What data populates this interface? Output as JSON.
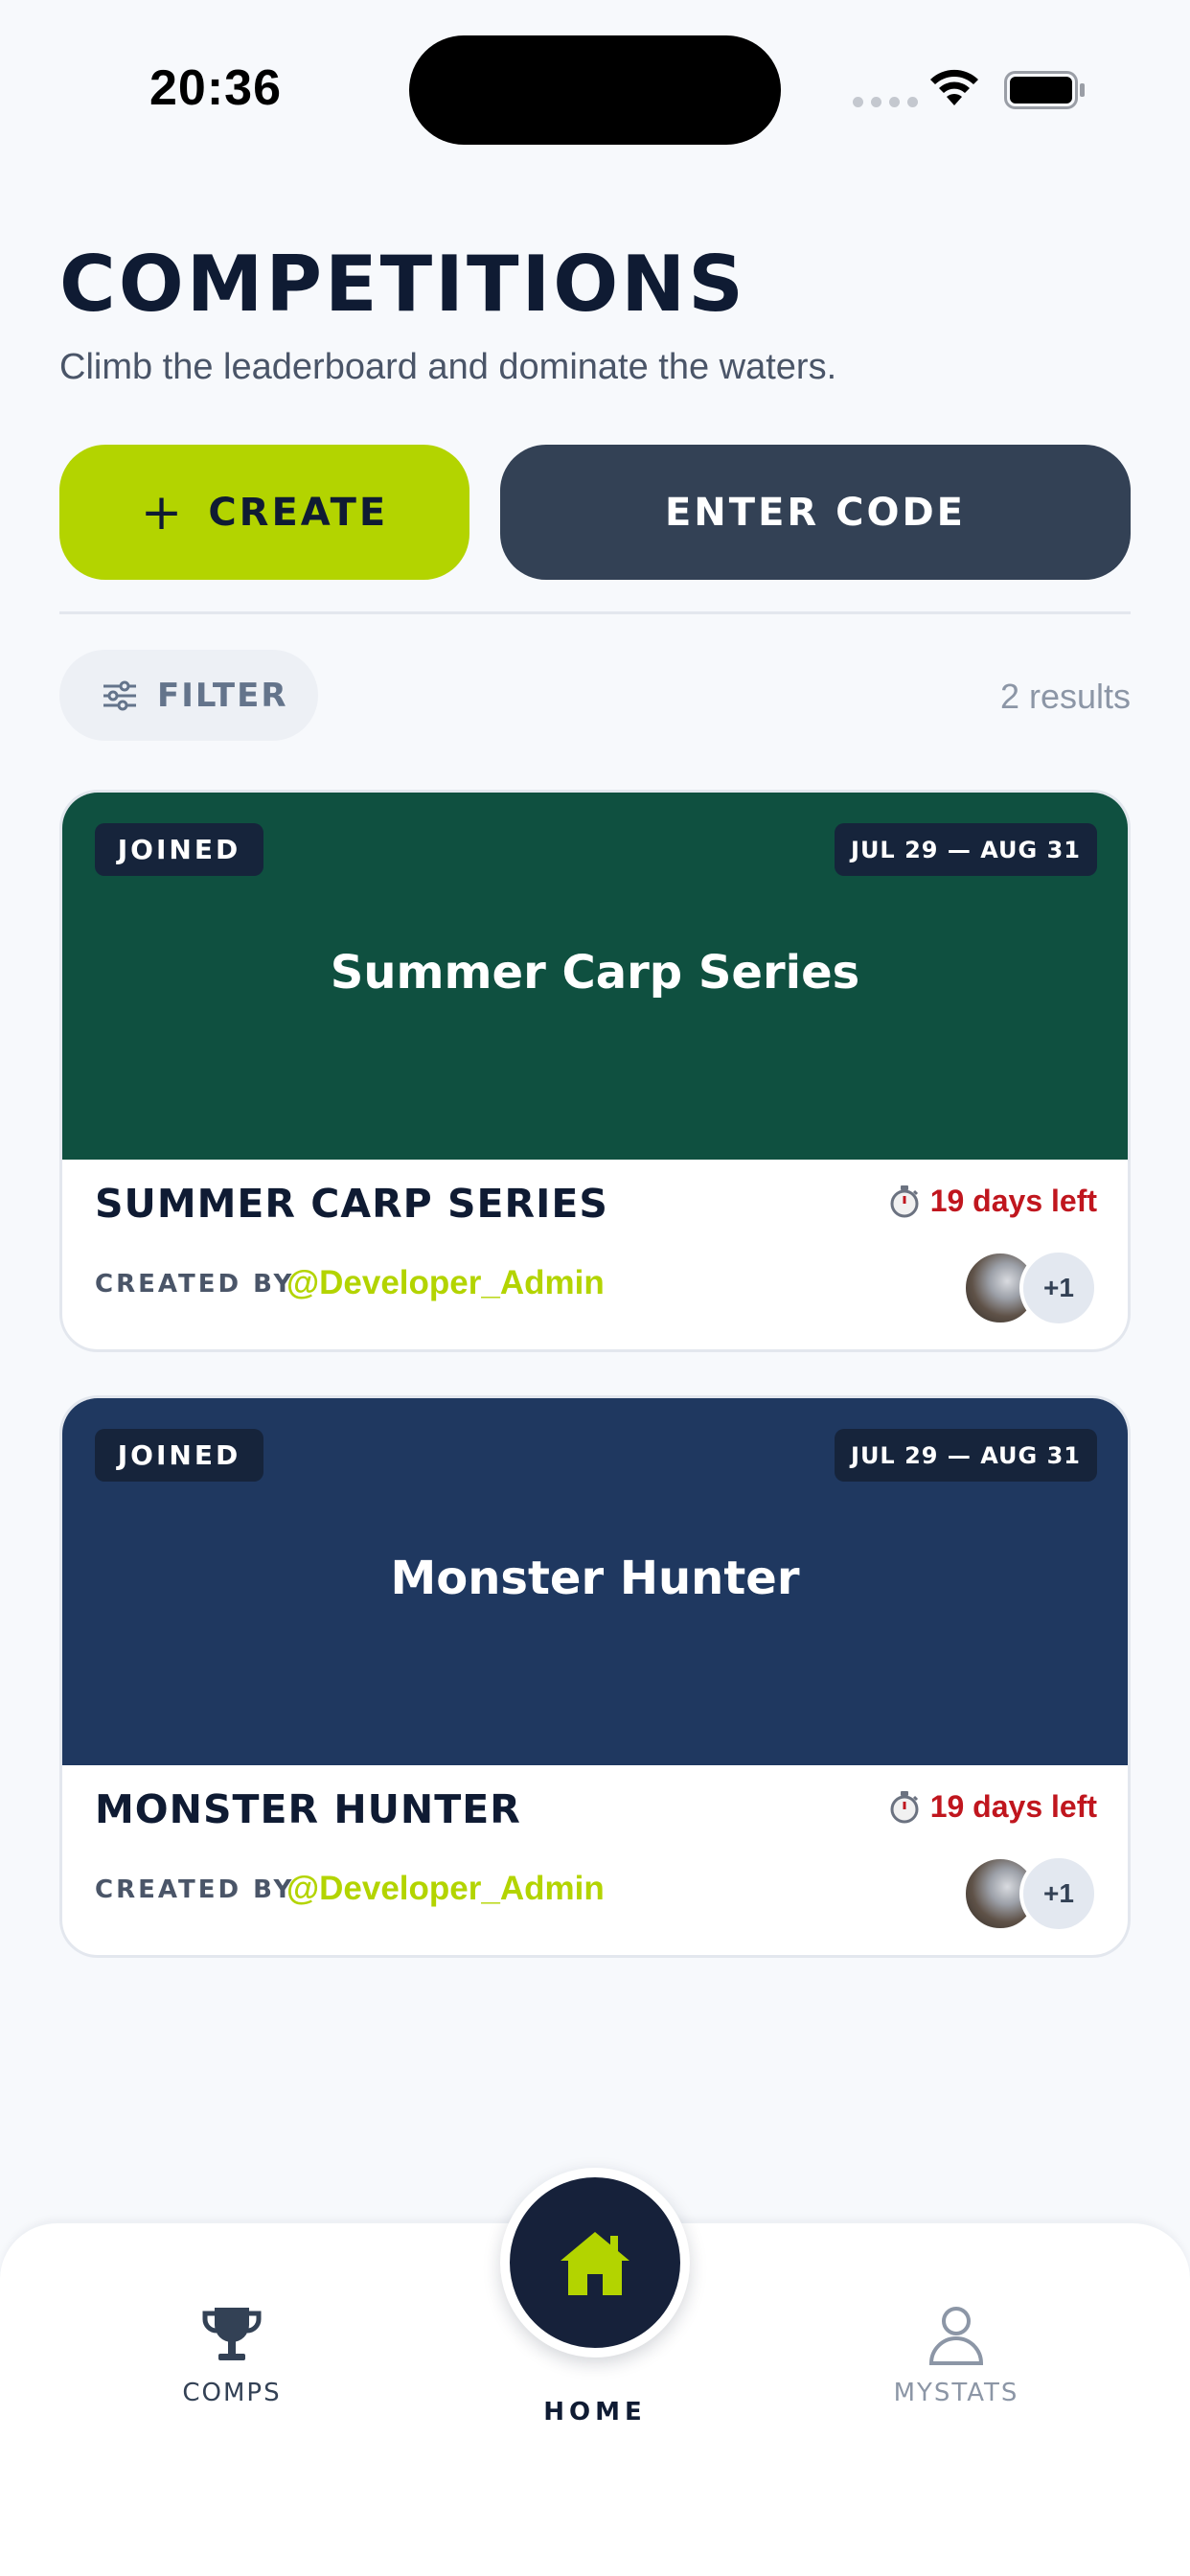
{
  "status_bar": {
    "time": "20:36"
  },
  "header": {
    "title": "COMPETITIONS",
    "subtitle": "Climb the leaderboard and dominate the waters."
  },
  "actions": {
    "create_label": "CREATE",
    "create_symbol": "+",
    "enter_code_label": "ENTER CODE"
  },
  "filter": {
    "label": "FILTER",
    "results": "2 results"
  },
  "competitions": [
    {
      "badge": "JOINED",
      "dates": "JUL 29 — AUG 31",
      "banner_title": "Summer Carp Series",
      "banner_color": "#0f5040",
      "name": "SUMMER CARP SERIES",
      "time_left": "19 days left",
      "created_by_label": "CREATED BY",
      "creator": "@Developer_Admin",
      "extra_participants": "+1"
    },
    {
      "badge": "JOINED",
      "dates": "JUL 29 — AUG 31",
      "banner_title": "Monster Hunter",
      "banner_color": "#1f3860",
      "name": "MONSTER HUNTER",
      "time_left": "19 days left",
      "created_by_label": "CREATED BY",
      "creator": "@Developer_Admin",
      "extra_participants": "+1"
    }
  ],
  "nav": {
    "comps_label": "COMPS",
    "home_label": "HOME",
    "mystats_label": "MYSTATS",
    "active": "home"
  },
  "colors": {
    "accent": "#b3d400",
    "navy": "#0f1b33",
    "slate_button": "#334155",
    "danger": "#c0161e"
  }
}
